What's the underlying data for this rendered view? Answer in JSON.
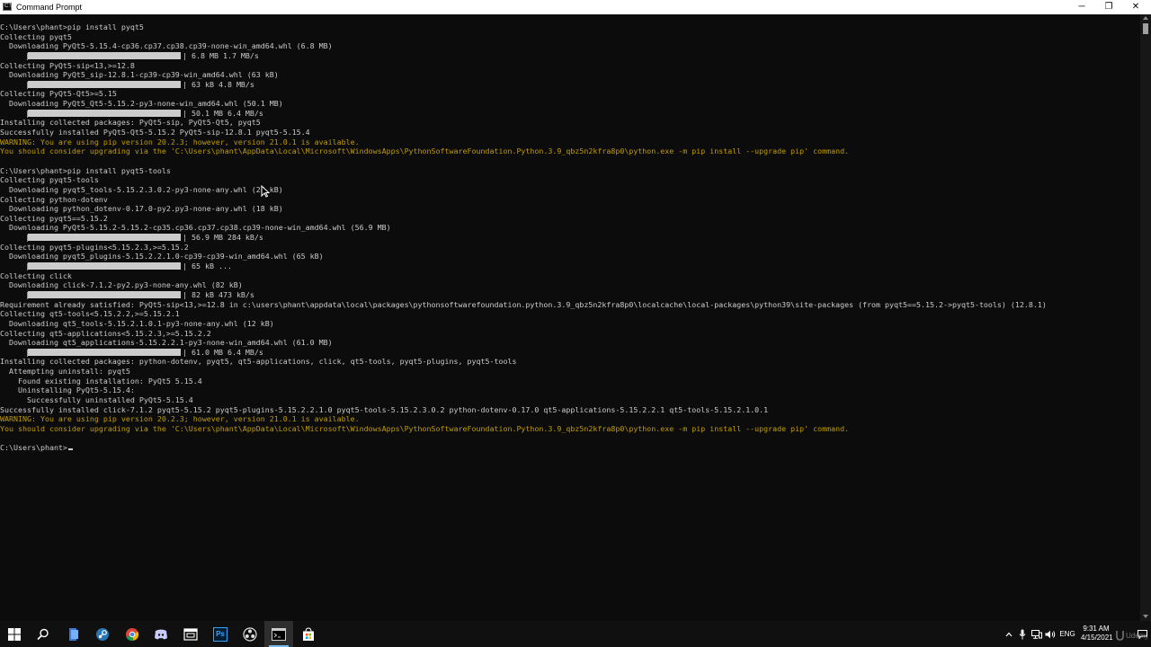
{
  "window": {
    "title": "Command Prompt",
    "minimize_glyph": "─",
    "maximize_glyph": "❐",
    "close_glyph": "✕"
  },
  "terminal": {
    "lines": [
      {
        "text": "C:\\Users\\phant>pip install pyqt5"
      },
      {
        "text": "Collecting pyqt5"
      },
      {
        "text": "  Downloading PyQt5-5.15.4-cp36.cp37.cp38.cp39-none-win_amd64.whl (6.8 MB)"
      },
      {
        "progress": 1.0,
        "text": "| 6.8 MB 1.7 MB/s"
      },
      {
        "text": "Collecting PyQt5-sip<13,>=12.8"
      },
      {
        "text": "  Downloading PyQt5_sip-12.8.1-cp39-cp39-win_amd64.whl (63 kB)"
      },
      {
        "progress": 1.0,
        "text": "| 63 kB 4.8 MB/s"
      },
      {
        "text": "Collecting PyQt5-Qt5>=5.15"
      },
      {
        "text": "  Downloading PyQt5_Qt5-5.15.2-py3-none-win_amd64.whl (50.1 MB)"
      },
      {
        "progress": 1.0,
        "text": "| 50.1 MB 6.4 MB/s"
      },
      {
        "text": "Installing collected packages: PyQt5-sip, PyQt5-Qt5, pyqt5"
      },
      {
        "text": "Successfully installed PyQt5-Qt5-5.15.2 PyQt5-sip-12.8.1 pyqt5-5.15.4"
      },
      {
        "text": "WARNING: You are using pip version 20.2.3; however, version 21.0.1 is available.",
        "warn": true
      },
      {
        "text": "You should consider upgrading via the 'C:\\Users\\phant\\AppData\\Local\\Microsoft\\WindowsApps\\PythonSoftwareFoundation.Python.3.9_qbz5n2kfra8p0\\python.exe -m pip install --upgrade pip' command.",
        "warn": true
      },
      {
        "text": ""
      },
      {
        "text": "C:\\Users\\phant>pip install pyqt5-tools"
      },
      {
        "text": "Collecting pyqt5-tools"
      },
      {
        "text": "  Downloading pyqt5_tools-5.15.2.3.0.2-py3-none-any.whl (28 kB)"
      },
      {
        "text": "Collecting python-dotenv"
      },
      {
        "text": "  Downloading python_dotenv-0.17.0-py2.py3-none-any.whl (18 kB)"
      },
      {
        "text": "Collecting pyqt5==5.15.2"
      },
      {
        "text": "  Downloading PyQt5-5.15.2-5.15.2-cp35.cp36.cp37.cp38.cp39-none-win_amd64.whl (56.9 MB)"
      },
      {
        "progress": 1.0,
        "text": "| 56.9 MB 284 kB/s"
      },
      {
        "text": "Collecting pyqt5-plugins<5.15.2.3,>=5.15.2"
      },
      {
        "text": "  Downloading pyqt5_plugins-5.15.2.2.1.0-cp39-cp39-win_amd64.whl (65 kB)"
      },
      {
        "progress": 1.0,
        "text": "| 65 kB ..."
      },
      {
        "text": "Collecting click"
      },
      {
        "text": "  Downloading click-7.1.2-py2.py3-none-any.whl (82 kB)"
      },
      {
        "progress": 1.0,
        "text": "| 82 kB 473 kB/s"
      },
      {
        "text": "Requirement already satisfied: PyQt5-sip<13,>=12.8 in c:\\users\\phant\\appdata\\local\\packages\\pythonsoftwarefoundation.python.3.9_qbz5n2kfra8p0\\localcache\\local-packages\\python39\\site-packages (from pyqt5==5.15.2->pyqt5-tools) (12.8.1)"
      },
      {
        "text": "Collecting qt5-tools<5.15.2.2,>=5.15.2.1"
      },
      {
        "text": "  Downloading qt5_tools-5.15.2.1.0.1-py3-none-any.whl (12 kB)"
      },
      {
        "text": "Collecting qt5-applications<5.15.2.3,>=5.15.2.2"
      },
      {
        "text": "  Downloading qt5_applications-5.15.2.2.1-py3-none-win_amd64.whl (61.0 MB)"
      },
      {
        "progress": 1.0,
        "text": "| 61.0 MB 6.4 MB/s"
      },
      {
        "text": "Installing collected packages: python-dotenv, pyqt5, qt5-applications, click, qt5-tools, pyqt5-plugins, pyqt5-tools"
      },
      {
        "text": "  Attempting uninstall: pyqt5"
      },
      {
        "text": "    Found existing installation: PyQt5 5.15.4"
      },
      {
        "text": "    Uninstalling PyQt5-5.15.4:"
      },
      {
        "text": "      Successfully uninstalled PyQt5-5.15.4"
      },
      {
        "text": "Successfully installed click-7.1.2 pyqt5-5.15.2 pyqt5-plugins-5.15.2.2.1.0 pyqt5-tools-5.15.2.3.0.2 python-dotenv-0.17.0 qt5-applications-5.15.2.2.1 qt5-tools-5.15.2.1.0.1"
      },
      {
        "text": "WARNING: You are using pip version 20.2.3; however, version 21.0.1 is available.",
        "warn": true
      },
      {
        "text": "You should consider upgrading via the 'C:\\Users\\phant\\AppData\\Local\\Microsoft\\WindowsApps\\PythonSoftwareFoundation.Python.3.9_qbz5n2kfra8p0\\python.exe -m pip install --upgrade pip' command.",
        "warn": true
      },
      {
        "text": ""
      },
      {
        "text": "C:\\Users\\phant>",
        "prompt": true
      }
    ]
  },
  "colors": {
    "terminal_bg": "#0c0c0c",
    "text": "#cccccc",
    "warning": "#c19c00",
    "accent": "#76b9ed"
  },
  "taskbar": {
    "apps": [
      {
        "name": "start-button",
        "icon": "windows-logo-icon"
      },
      {
        "name": "search-button",
        "icon": "search-icon"
      },
      {
        "name": "app-file-explorer",
        "icon": "file-explorer-icon"
      },
      {
        "name": "app-steam",
        "icon": "steam-icon"
      },
      {
        "name": "app-chrome",
        "icon": "chrome-icon"
      },
      {
        "name": "app-discord",
        "icon": "discord-icon"
      },
      {
        "name": "app-qt-designer",
        "icon": "qt-designer-icon"
      },
      {
        "name": "app-photoshop",
        "icon": "photoshop-icon",
        "label": "Ps"
      },
      {
        "name": "app-obs",
        "icon": "obs-icon"
      },
      {
        "name": "app-command-prompt",
        "icon": "command-prompt-icon",
        "active": true
      },
      {
        "name": "app-store",
        "icon": "store-icon"
      }
    ],
    "tray": {
      "language": "ENG",
      "time": "9:31 AM",
      "date": "4/15/2021"
    }
  }
}
